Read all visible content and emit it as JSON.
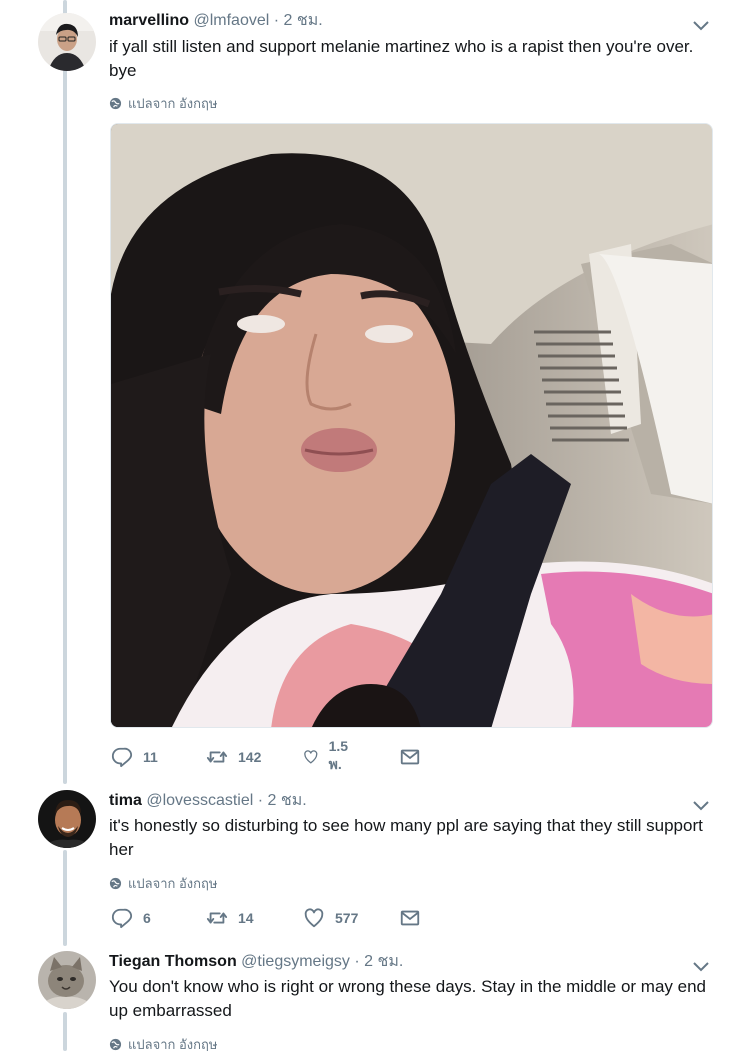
{
  "tweets": [
    {
      "name": "marvellino",
      "handle": "@lmfaovel",
      "sep": "·",
      "time": "2 ชม.",
      "text": "if yall still listen and support melanie martinez who is a rapist then you're over. bye",
      "translate": "แปลจาก อังกฤษ",
      "replies": "11",
      "retweets": "142",
      "likes": "1.5 พ."
    },
    {
      "name": "tima",
      "handle": "@lovesscastiel",
      "sep": "·",
      "time": "2 ชม.",
      "text": "it's honestly so disturbing to see how many ppl are saying that they still support her",
      "translate": "แปลจาก อังกฤษ",
      "replies": "6",
      "retweets": "14",
      "likes": "577"
    },
    {
      "name": "Tiegan Thomson",
      "handle": "@tiegsymeigsy",
      "sep": "·",
      "time": "2 ชม.",
      "text": "You don't know who is right or wrong these days. Stay in the middle or may end up embarrassed",
      "translate": "แปลจาก อังกฤษ"
    }
  ],
  "icons": {
    "reply": "reply-icon",
    "retweet": "retweet-icon",
    "like": "heart-icon",
    "dm": "envelope-icon",
    "translate": "globe-icon",
    "menu": "chevron-down-icon"
  },
  "colors": {
    "text": "#14171a",
    "muted": "#657786",
    "thread": "#ccd6dd"
  }
}
